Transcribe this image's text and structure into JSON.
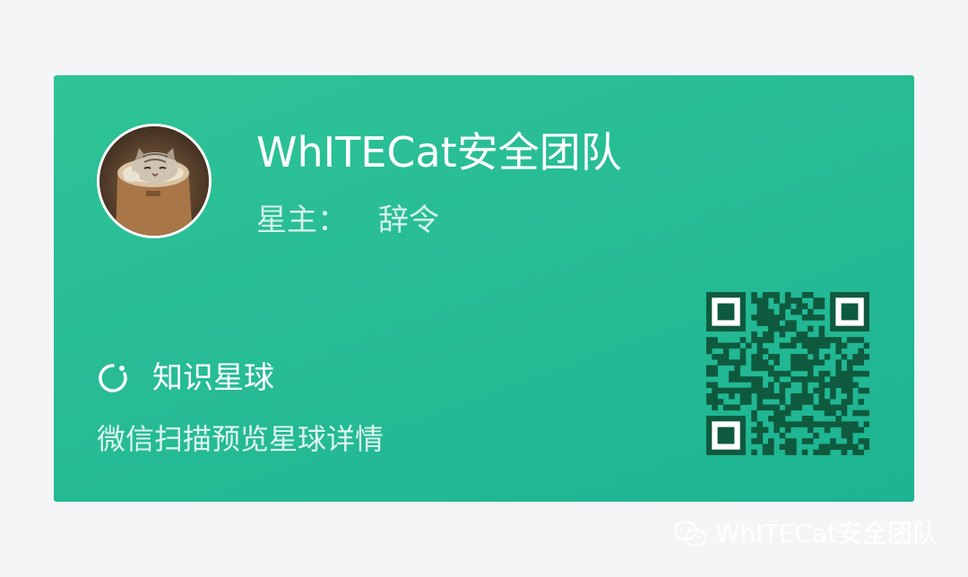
{
  "page": {
    "background_color": "#f4f5f7"
  },
  "card": {
    "gradient_start": "#2fc397",
    "gradient_end": "#1db492",
    "avatar_icon": "cat-in-boot-avatar",
    "team_name": "WhITECat安全团队",
    "owner_label": "星主：",
    "owner_name": "辞令",
    "planet_icon": "loading-ring-icon",
    "planet_label": "知识星球",
    "hint": "微信扫描预览星球详情",
    "qr_icon": "qr-code",
    "qr_color": "#0f5a3e"
  },
  "watermark": {
    "icon": "wechat-icon",
    "text": "WhITECat安全团队"
  }
}
